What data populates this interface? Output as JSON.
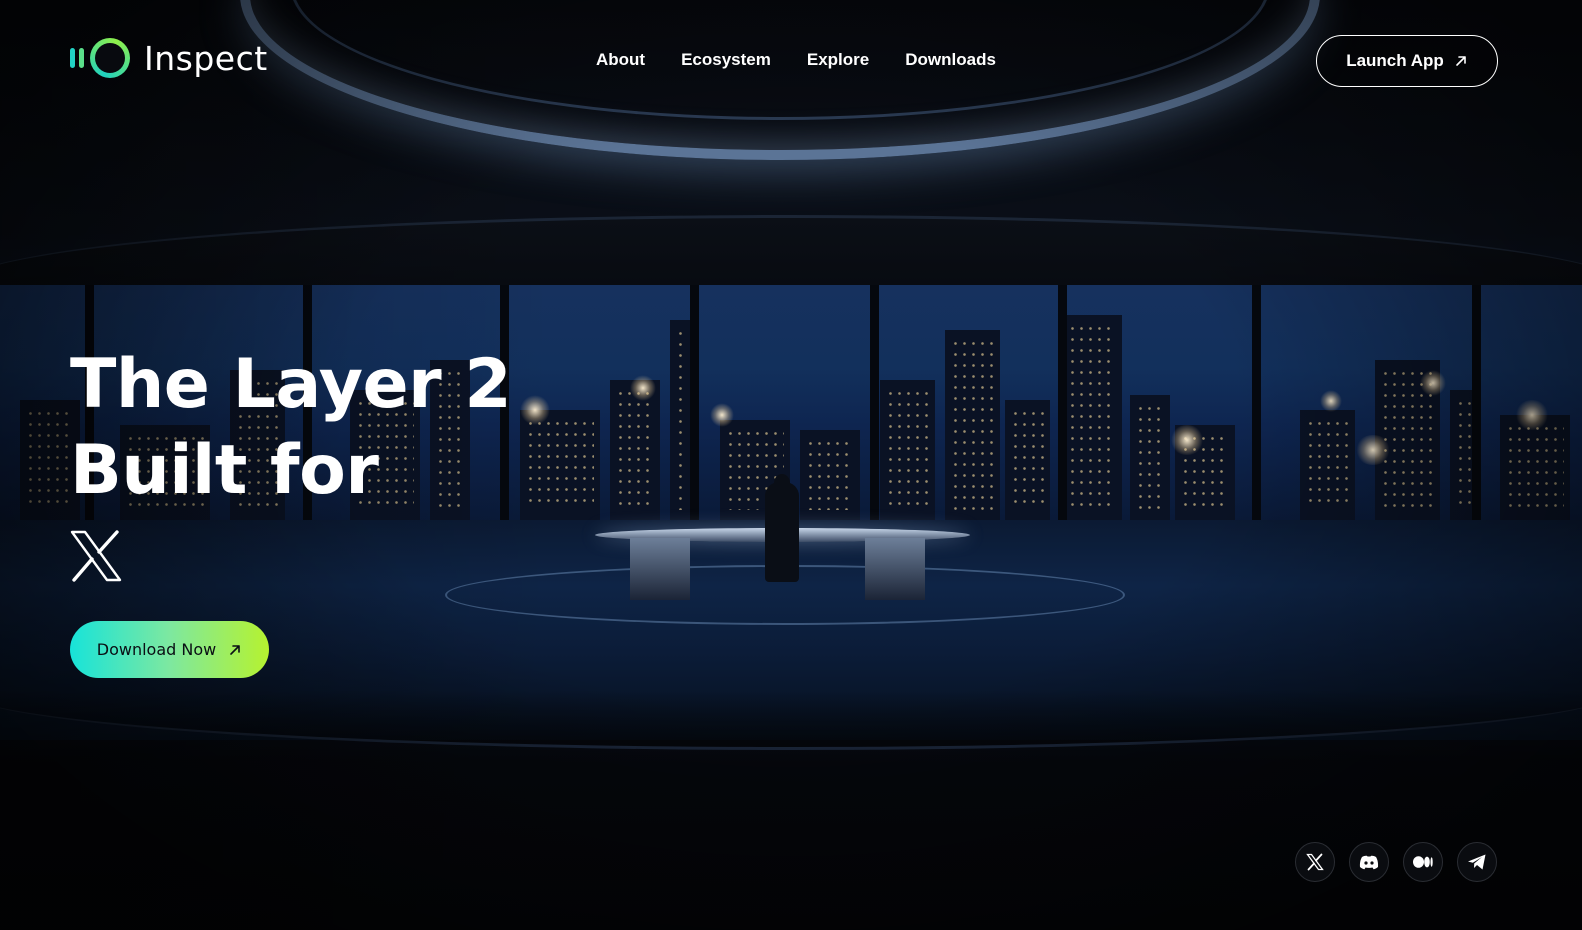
{
  "brand": {
    "name": "Inspect"
  },
  "nav": {
    "items": [
      {
        "label": "About"
      },
      {
        "label": "Ecosystem"
      },
      {
        "label": "Explore"
      },
      {
        "label": "Downloads"
      }
    ]
  },
  "header": {
    "launch_label": "Launch App"
  },
  "hero": {
    "title_line1": "The Layer 2",
    "title_line2": "Built for",
    "platform_icon": "x-logo-icon",
    "cta_label": "Download Now"
  },
  "socials": [
    {
      "icon": "x-icon"
    },
    {
      "icon": "discord-icon"
    },
    {
      "icon": "medium-icon"
    },
    {
      "icon": "telegram-icon"
    }
  ],
  "colors": {
    "accent_start": "#17e3d9",
    "accent_end": "#b6f22f",
    "background": "#05070c",
    "text": "#ffffff"
  }
}
